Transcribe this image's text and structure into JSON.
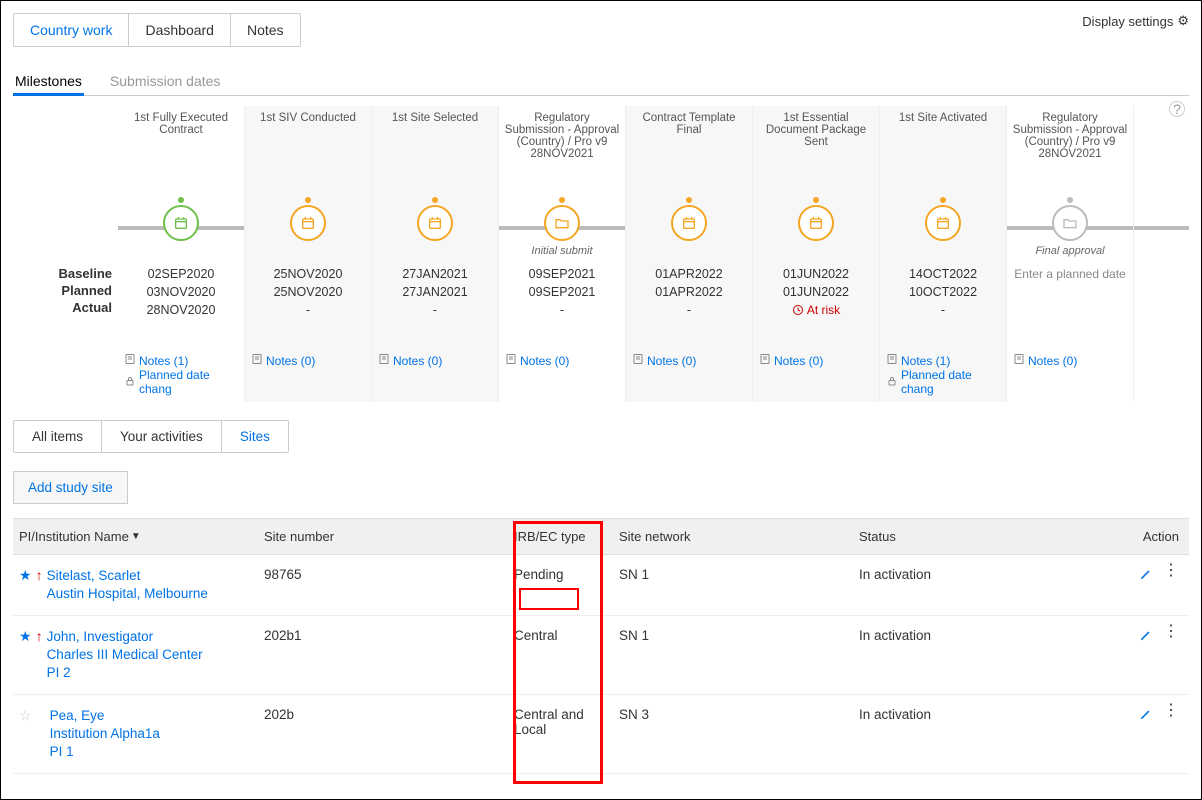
{
  "displaySettings": "Display settings",
  "topTabs": {
    "country": "Country work",
    "dashboard": "Dashboard",
    "notes": "Notes"
  },
  "subTabs": {
    "milestones": "Milestones",
    "submission": "Submission dates"
  },
  "rowLabels": {
    "baseline": "Baseline",
    "planned": "Planned",
    "actual": "Actual"
  },
  "milestoneItems": [
    {
      "title": "1st Fully Executed Contract",
      "sub": "",
      "baseline": "02SEP2020",
      "planned": "03NOV2020",
      "actual": "28NOV2020",
      "notes": "Notes (1)",
      "extra": "Planned date chang",
      "circle": "green",
      "icon": "cal"
    },
    {
      "title": "1st SIV Conducted",
      "sub": "",
      "baseline": "25NOV2020",
      "planned": "25NOV2020",
      "actual": "-",
      "notes": "Notes (0)",
      "extra": "",
      "circle": "orange",
      "icon": "cal"
    },
    {
      "title": "1st Site Selected",
      "sub": "",
      "baseline": "27JAN2021",
      "planned": "27JAN2021",
      "actual": "-",
      "notes": "Notes (0)",
      "extra": "",
      "circle": "orange",
      "icon": "cal"
    },
    {
      "title": "Regulatory Submission - Approval (Country) / Pro v9 28NOV2021",
      "sub": "Initial submit",
      "baseline": "09SEP2021",
      "planned": "09SEP2021",
      "actual": "-",
      "notes": "Notes (0)",
      "extra": "",
      "circle": "orange",
      "icon": "folder"
    },
    {
      "title": "Contract Template Final",
      "sub": "",
      "baseline": "01APR2022",
      "planned": "01APR2022",
      "actual": "-",
      "notes": "Notes (0)",
      "extra": "",
      "circle": "orange",
      "icon": "cal"
    },
    {
      "title": "1st Essential Document Package Sent",
      "sub": "",
      "baseline": "01JUN2022",
      "planned": "01JUN2022",
      "actual": "",
      "risk": "At risk",
      "notes": "Notes (0)",
      "extra": "",
      "circle": "orange",
      "icon": "cal"
    },
    {
      "title": "1st Site Activated",
      "sub": "",
      "baseline": "14OCT2022",
      "planned": "10OCT2022",
      "actual": "-",
      "notes": "Notes (1)",
      "extra": "Planned date chang",
      "circle": "orange",
      "icon": "cal"
    },
    {
      "title": "Regulatory Submission - Approval (Country) / Pro v9 28NOV2021",
      "sub": "Final approval",
      "baseline": "",
      "planned": "Enter a planned date",
      "actual": "",
      "notes": "Notes (0)",
      "extra": "",
      "circle": "grey",
      "icon": "folder"
    }
  ],
  "filterTabs": {
    "all": "All items",
    "your": "Your activities",
    "sites": "Sites"
  },
  "addButton": "Add study site",
  "headers": {
    "pi": "PI/Institution Name",
    "site": "Site number",
    "irb": "IRB/EC type",
    "net": "Site network",
    "status": "Status",
    "action": "Action"
  },
  "rows": [
    {
      "star": true,
      "arrow": true,
      "pi": "Sitelast, Scarlet",
      "inst": "Austin Hospital, Melbourne",
      "pi2": "",
      "site": "98765",
      "irb": "Pending",
      "net": "SN 1",
      "status": "In activation"
    },
    {
      "star": true,
      "arrow": true,
      "pi": "John, Investigator",
      "inst": "Charles III Medical Center",
      "pi2": "PI 2",
      "site": "202b1",
      "irb": "Central",
      "net": "SN 1",
      "status": "In activation"
    },
    {
      "star": false,
      "arrow": false,
      "pi": "Pea, Eye",
      "inst": "Institution Alpha1a",
      "pi2": "PI 1",
      "site": "202b",
      "irb": "Central and Local",
      "net": "SN 3",
      "status": "In activation"
    }
  ]
}
